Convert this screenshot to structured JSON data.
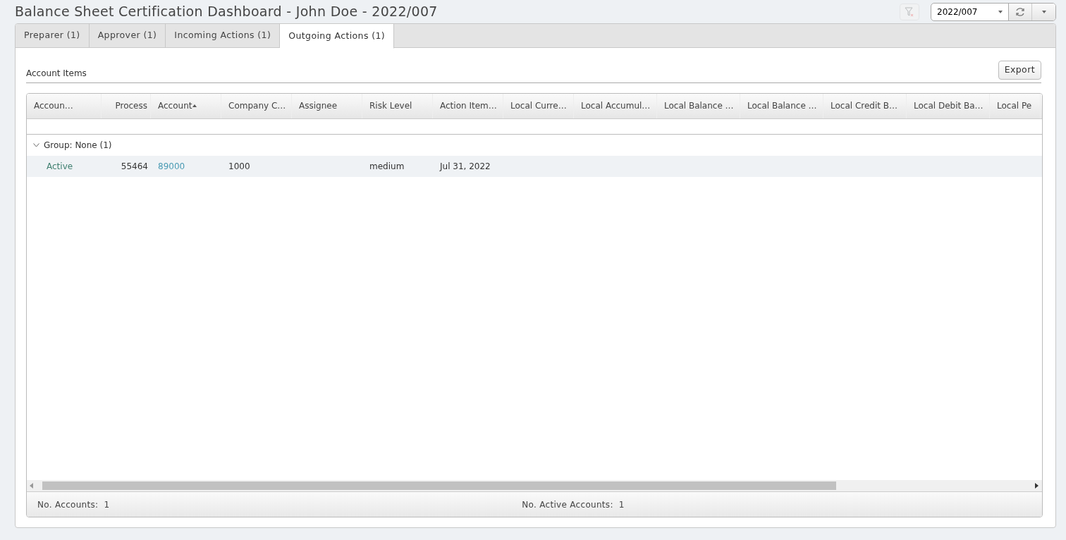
{
  "window": {
    "title": "Balance Sheet Certification Dashboard - John Doe - 2022/007"
  },
  "toolbar": {
    "filter_clear_disabled": true,
    "period": "2022/007"
  },
  "tabs": [
    {
      "label": "Preparer (1)",
      "selected": false
    },
    {
      "label": "Approver (1)",
      "selected": false
    },
    {
      "label": "Incoming Actions (1)",
      "selected": false
    },
    {
      "label": "Outgoing Actions (1)",
      "selected": true
    }
  ],
  "section": {
    "title": "Account Items",
    "export_button": "Export"
  },
  "table": {
    "columns": [
      {
        "label": "Accoun…",
        "sorted": false
      },
      {
        "label": "Process",
        "sorted": false
      },
      {
        "label": "Account",
        "sorted": true
      },
      {
        "label": "Company C…",
        "sorted": false
      },
      {
        "label": "Assignee",
        "sorted": false
      },
      {
        "label": "Risk Level",
        "sorted": false
      },
      {
        "label": "Action Item…",
        "sorted": false
      },
      {
        "label": "Local Curre…",
        "sorted": false
      },
      {
        "label": "Local Accumul…",
        "sorted": false
      },
      {
        "label": "Local Balance …",
        "sorted": false
      },
      {
        "label": "Local Balance …",
        "sorted": false
      },
      {
        "label": "Local Credit B…",
        "sorted": false
      },
      {
        "label": "Local Debit Ba…",
        "sorted": false
      },
      {
        "label": "Local Pe",
        "sorted": false
      }
    ],
    "groups": [
      {
        "label": "Group: None (1)",
        "expanded": true,
        "rows": [
          {
            "cells": [
              {
                "text": "Active",
                "kind": "status"
              },
              {
                "text": "55464",
                "kind": "number"
              },
              {
                "text": "89000",
                "kind": "link"
              },
              {
                "text": "1000",
                "kind": "text"
              },
              {
                "text": "",
                "kind": "text"
              },
              {
                "text": "medium",
                "kind": "text"
              },
              {
                "text": "Jul 31, 2022",
                "kind": "text"
              }
            ]
          }
        ]
      }
    ]
  },
  "footer": [
    {
      "label": "No. Accounts:",
      "value": "1"
    },
    {
      "label": "No. Active Accounts:",
      "value": "1"
    }
  ]
}
